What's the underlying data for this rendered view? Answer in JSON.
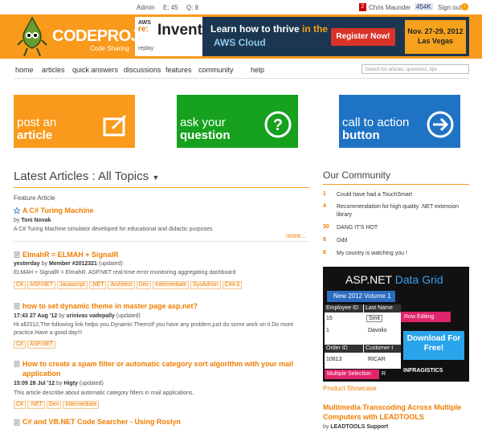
{
  "topbar": {
    "admin": "Admin",
    "e_count": "E: 45",
    "q_count": "Q: 8",
    "notifications": "2",
    "user": "Chris Maunder",
    "reputation": "454K",
    "signout": "Sign out"
  },
  "logo": {
    "name": "CODEPROJECT",
    "tagline": "Code Sharing"
  },
  "ad": {
    "aws": "AWS",
    "re": "re:",
    "invent": "Invent",
    "replay": "replay",
    "headline1_pre": "Learn how to thrive",
    "headline1_accent": " in the",
    "headline2": "AWS Cloud",
    "register": "Register Now!",
    "date_line1": "Nov. 27-29, 2012",
    "date_line2": "Las Vegas"
  },
  "nav": {
    "items": [
      "home",
      "articles",
      "quick answers",
      "discussions",
      "features",
      "community",
      "help"
    ],
    "search_placeholder": "Search for articles, questions, tips"
  },
  "tiles": [
    {
      "line1": "post an",
      "line2": "article",
      "color": "#f99a1c"
    },
    {
      "line1": "ask your",
      "line2": "question",
      "color": "#16a11f"
    },
    {
      "line1": "call to action",
      "line2": "button",
      "color": "#1f73c4"
    }
  ],
  "latest": {
    "heading": "Latest Articles :  All Topics",
    "feature_label": "Feature Article",
    "featured": {
      "title": "A C# Turing Machine",
      "by": "by",
      "author": "Toni Novak",
      "desc": "A C# Turing Machine simulator developed for educational and didactic purposes",
      "more": "more..."
    },
    "articles": [
      {
        "title": "ElmahR = ELMAH + SignalR",
        "when": "yesterday",
        "by": "by",
        "author": "Member #2012321",
        "status": "(updated)",
        "desc": "ELMAH + SignalR = ElmahR. ASP.NET real-time error monitoring aggregating dashboard",
        "tags": [
          "C#",
          "ASP.NET",
          "Javascript",
          ".NET",
          "Architect",
          "Dev",
          "Intermediate",
          "SysAdmin",
          "C#4.0"
        ]
      },
      {
        "title": "how to set dynamic theme in master page asp.net?",
        "when": "17:43 27 Aug '12",
        "by": "by",
        "author": "srinivas vadepally",
        "status": "(updated)",
        "desc": "Hi all2012,The following link helps you.Dynamic ThemsIf you have any problem,just do some work on it.Do more practice.Have a good day!!!",
        "tags": [
          "C#",
          "ASP.NET"
        ]
      },
      {
        "title": "How to create a spam filter or automatic category sort algorithm with your mail application",
        "when": "15:09 28 Jul '12",
        "by": "by",
        "author": "Higty",
        "status": "(updated)",
        "desc": "This article describe about automatic category filters in mail applications.",
        "tags": [
          "C#",
          ".NET",
          "Dev",
          "Intermediate"
        ]
      },
      {
        "title": "C# and VB.NET Code Searcher - Using Roslyn"
      }
    ]
  },
  "community": {
    "heading": "Our Community",
    "items": [
      {
        "n": "1",
        "text": "Could have had a TouchSmart"
      },
      {
        "n": "4",
        "text": "Recommendation for high quality .NET extension library"
      },
      {
        "n": "30",
        "text": "DANG IT'S HOT"
      },
      {
        "n": "8",
        "text": "Odd"
      },
      {
        "n": "8",
        "text": "My country is watching you !"
      }
    ]
  },
  "grid_ad": {
    "title_a": "ASP.NET ",
    "title_b": "Data Grid",
    "vol": "New 2012 Volume 1",
    "col1": "Employee ID",
    "col2": "Last Name",
    "r1c1": "15",
    "r1c2": "Smit",
    "r2c1": "1",
    "r2c2": "Davolio",
    "col3": "Order ID",
    "col4": "Customer I",
    "r3c1": "10813",
    "r3c2": "RICAR",
    "row_edit": "Row Editing",
    "download": "Download For Free!",
    "multi": "Multiple Selection",
    "r4c2": "R",
    "infra": "INFRAGISTICS"
  },
  "sidebar": {
    "product_showcase": "Product Showcase",
    "multi_title": "Multimedia Transcoding Across Multiple Computers with LEADTOOLS",
    "multi_by": "by",
    "multi_author": "LEADTOOLS Support"
  }
}
